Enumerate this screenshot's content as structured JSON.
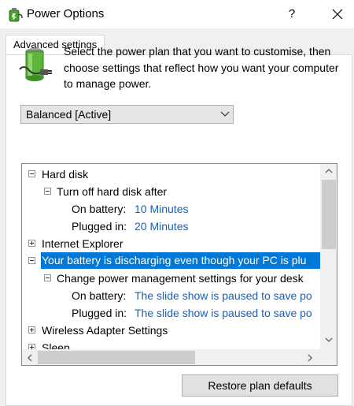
{
  "window": {
    "title": "Power Options",
    "help_label": "?"
  },
  "tab": {
    "label": "Advanced settings"
  },
  "intro": {
    "text": "Select the power plan that you want to customise, then choose settings that reflect how you want your computer to manage power."
  },
  "plan_select": {
    "value": "Balanced [Active]"
  },
  "tree": {
    "hard_disk": "Hard disk",
    "turn_off_hard_disk": "Turn off hard disk after",
    "hd_on_battery_label": "On battery:",
    "hd_on_battery_value": "10 Minutes",
    "hd_plugged_in_label": "Plugged in:",
    "hd_plugged_in_value": "20 Minutes",
    "internet_explorer": "Internet Explorer",
    "battery_discharging": "Your battery is discharging even though your PC is plu",
    "change_power_mgmt": "Change power management settings for your desk",
    "ss_on_battery_label": "On battery:",
    "ss_on_battery_value": "The slide show is paused to save po",
    "ss_plugged_in_label": "Plugged in:",
    "ss_plugged_in_value": "The slide show is paused to save po",
    "wireless_adapter": "Wireless Adapter Settings",
    "sleep": "Sleep"
  },
  "restore_button": {
    "label": "Restore plan defaults"
  },
  "colors": {
    "selection": "#0078d7",
    "value_link": "#1a5fb4",
    "dialog_bg": "#f0f0f0"
  }
}
